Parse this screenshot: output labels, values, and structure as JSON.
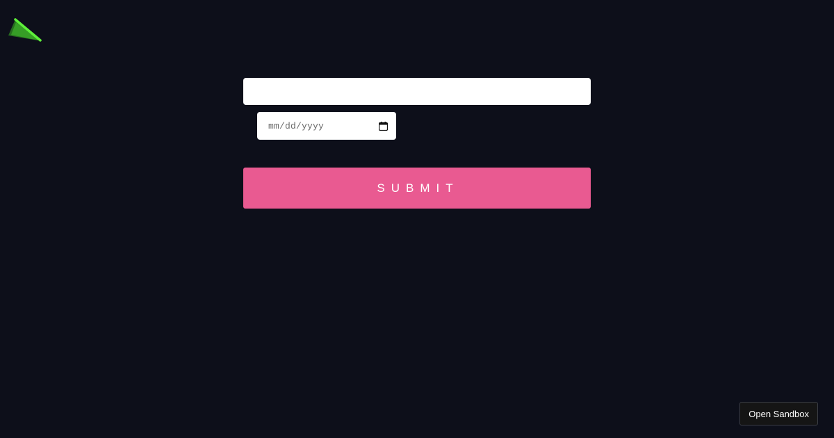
{
  "logo": {
    "icon": "green-wedge-logo",
    "color": "#4cdf2f"
  },
  "form": {
    "text_input": {
      "value": "",
      "placeholder": ""
    },
    "date_input": {
      "display_text": "mm/dd/yyyy",
      "icon": "calendar-icon"
    },
    "submit_label": "SUBMIT",
    "submit_color": "#e95a91"
  },
  "sandbox": {
    "label": "Open Sandbox"
  },
  "colors": {
    "background": "#0d0f1a",
    "input_background": "#ffffff"
  }
}
